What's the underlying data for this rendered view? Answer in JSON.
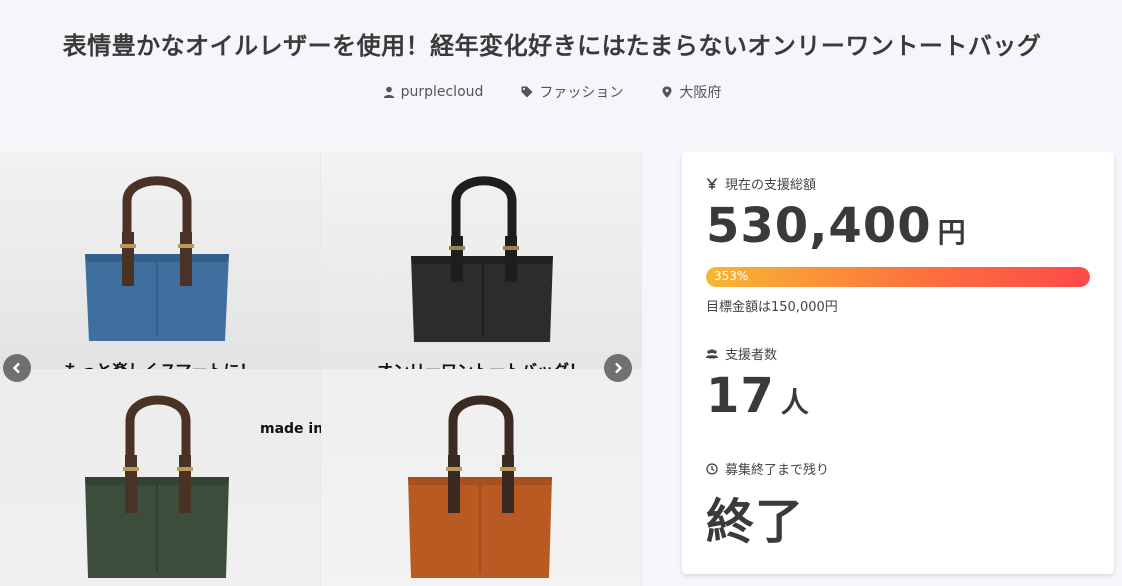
{
  "header": {
    "title": "表情豊かなオイルレザーを使用！経年変化好きにはたまらないオンリーワントートバッグ",
    "author": "purplecloud",
    "category": "ファッション",
    "location": "大阪府"
  },
  "gallery": {
    "caption_left": "もっと楽しくスマートに！",
    "caption_right": "オンリーワントートバッグ！",
    "caption_center": "made in Japan",
    "bag_colors": [
      "#3e6f9f",
      "#2b2c2b",
      "#3d4d3c",
      "#b95a23"
    ]
  },
  "funding": {
    "total_label": "現在の支援総額",
    "total_amount": "530,400",
    "total_unit": "円",
    "progress_percent": 353,
    "progress_text": "353%",
    "goal_text": "目標金額は150,000円",
    "supporters_label": "支援者数",
    "supporters_count": "17",
    "supporters_unit": "人",
    "remaining_label": "募集終了まで残り",
    "remaining_value": "終了"
  },
  "colors": {
    "accent_start": "#f7b733",
    "accent_end": "#fc4a4a"
  }
}
